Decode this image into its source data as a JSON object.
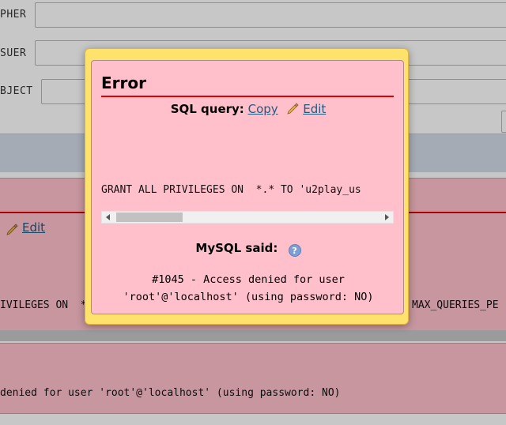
{
  "background": {
    "fields": [
      {
        "label": "PHER"
      },
      {
        "label": "SUER"
      },
      {
        "label": "BJECT"
      }
    ],
    "edit_label": "Edit",
    "query_fragment": "IVILEGES ON  *",
    "query_fragment_right": "MAX_QUERIES_PE",
    "error_fragment": "denied for user 'root'@'localhost' (using password: NO)"
  },
  "dialog": {
    "title": "Error",
    "sql_query_label": "SQL query:",
    "copy_label": "Copy",
    "edit_label": "Edit",
    "query_text": "GRANT ALL PRIVILEGES ON  *.* TO 'u2play_us",
    "mysql_said_label": "MySQL said:",
    "help_icon_glyph": "?",
    "error_line1": "#1045 - Access denied for user",
    "error_line2": "'root'@'localhost' (using password: NO)"
  },
  "colors": {
    "dialog_border": "#ffe26b",
    "error_bg": "#ffc0cb",
    "rule_red": "#dd0000",
    "link_blue": "#235a81"
  }
}
